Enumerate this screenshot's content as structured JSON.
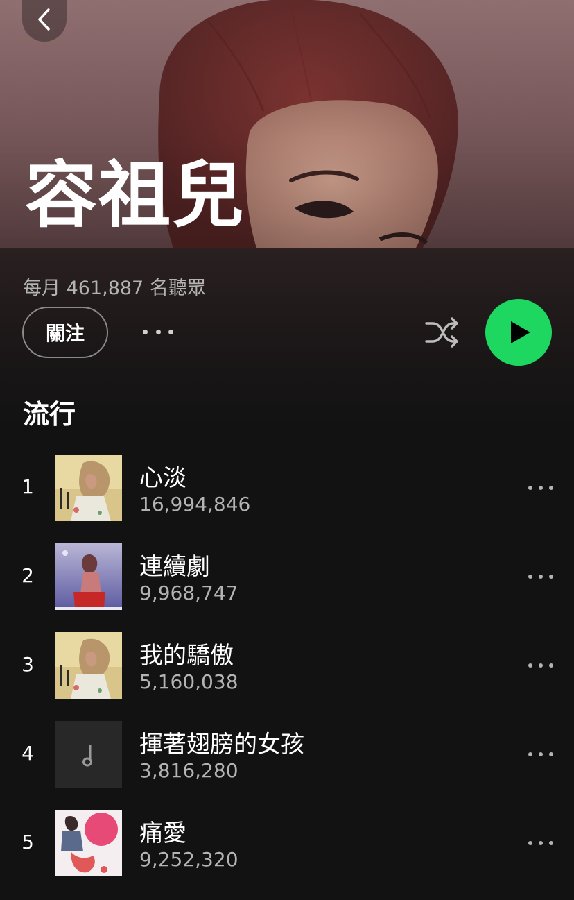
{
  "artist": {
    "name": "容祖兒",
    "monthly_listeners": "每月 461,887 名聽眾"
  },
  "actions": {
    "follow_label": "關注"
  },
  "section": {
    "title": "流行"
  },
  "tracks": [
    {
      "rank": "1",
      "title": "心淡",
      "plays": "16,994,846",
      "art": "album-cover-1"
    },
    {
      "rank": "2",
      "title": "連續劇",
      "plays": "9,968,747",
      "art": "album-cover-2"
    },
    {
      "rank": "3",
      "title": "我的驕傲",
      "plays": "5,160,038",
      "art": "album-cover-1"
    },
    {
      "rank": "4",
      "title": "揮著翅膀的女孩",
      "plays": "3,816,280",
      "art": "music-note-placeholder"
    },
    {
      "rank": "5",
      "title": "痛愛",
      "plays": "9,252,320",
      "art": "album-cover-3"
    }
  ],
  "colors": {
    "accent": "#1ed760",
    "background": "#121212",
    "secondary_text": "#b3b3b3"
  }
}
